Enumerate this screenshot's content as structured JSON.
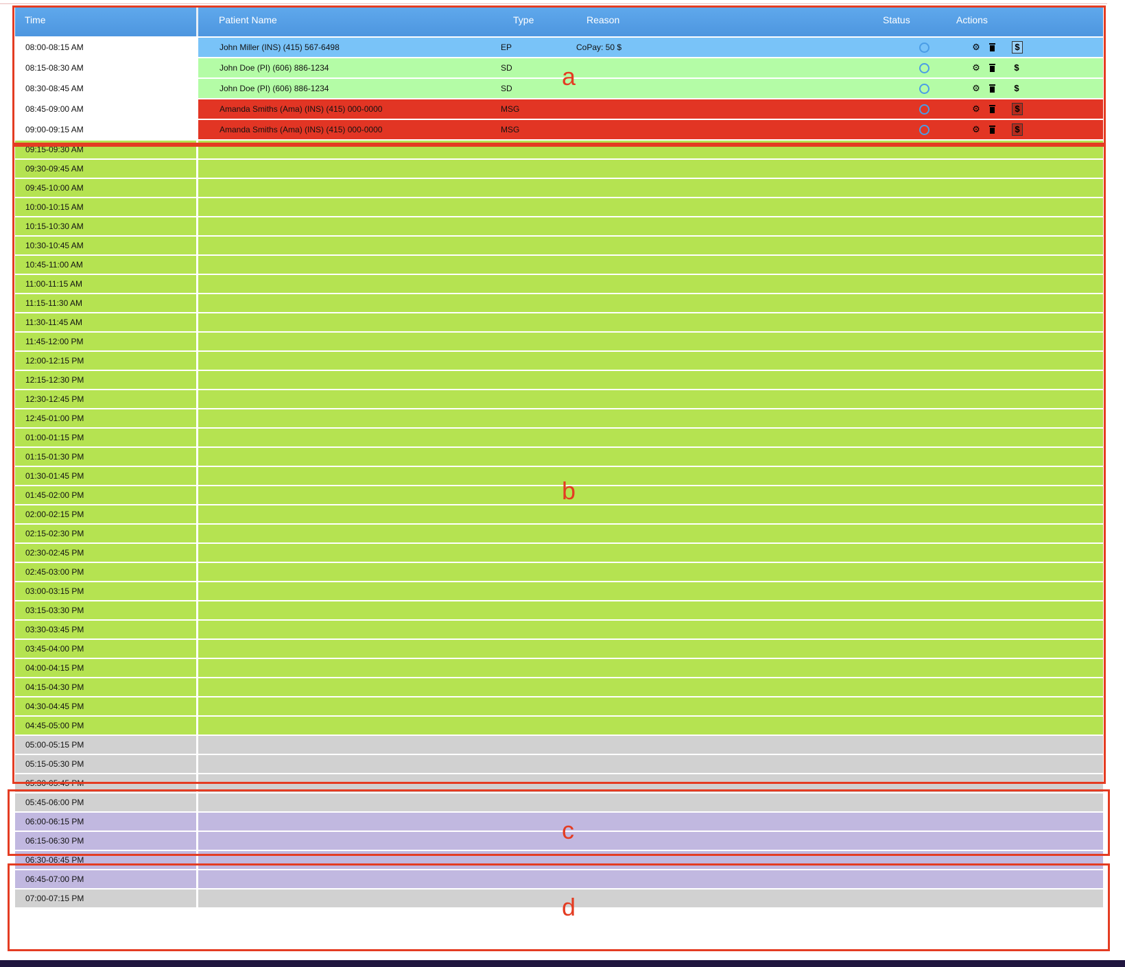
{
  "header": {
    "time": "Time",
    "patient_name": "Patient Name",
    "type": "Type",
    "reason": "Reason",
    "status": "Status",
    "actions": "Actions"
  },
  "appointments": [
    {
      "time": "08:00-08:15 AM",
      "patient": "John Miller (INS)  (415) 567-6498",
      "type": "EP",
      "reason": "CoPay: 50 $"
    },
    {
      "time": "08:15-08:30 AM",
      "patient": "John Doe (PI)  (606) 886-1234",
      "type": "SD",
      "reason": ""
    },
    {
      "time": "08:30-08:45 AM",
      "patient": "John Doe (PI)  (606) 886-1234",
      "type": "SD",
      "reason": ""
    },
    {
      "time": "08:45-09:00 AM",
      "patient": "Amanda Smiths (Ama) (INS)  (415) 000-0000",
      "type": "MSG",
      "reason": ""
    },
    {
      "time": "09:00-09:15 AM",
      "patient": "Amanda Smiths (Ama) (INS)  (415) 000-0000",
      "type": "MSG",
      "reason": ""
    }
  ],
  "open_slots": [
    "09:15-09:30 AM",
    "09:30-09:45 AM",
    "09:45-10:00 AM",
    "10:00-10:15 AM",
    "10:15-10:30 AM",
    "10:30-10:45 AM",
    "10:45-11:00 AM",
    "11:00-11:15 AM",
    "11:15-11:30 AM",
    "11:30-11:45 AM",
    "11:45-12:00 PM",
    "12:00-12:15 PM",
    "12:15-12:30 PM",
    "12:30-12:45 PM",
    "12:45-01:00 PM",
    "01:00-01:15 PM",
    "01:15-01:30 PM",
    "01:30-01:45 PM",
    "01:45-02:00 PM",
    "02:00-02:15 PM",
    "02:15-02:30 PM",
    "02:30-02:45 PM",
    "02:45-03:00 PM",
    "03:00-03:15 PM",
    "03:15-03:30 PM",
    "03:30-03:45 PM",
    "03:45-04:00 PM",
    "04:00-04:15 PM",
    "04:15-04:30 PM",
    "04:30-04:45 PM",
    "04:45-05:00 PM"
  ],
  "gray_slots": [
    "05:00-05:15 PM",
    "05:15-05:30 PM",
    "05:30-05:45 PM",
    "05:45-06:00 PM"
  ],
  "purple_slots": [
    "06:00-06:15 PM",
    "06:15-06:30 PM",
    "06:30-06:45 PM",
    "06:45-07:00 PM"
  ],
  "trailing_slots": [
    "07:00-07:15 PM"
  ],
  "annotations": {
    "a": "a",
    "b": "b",
    "c": "c",
    "d": "d"
  },
  "icons": {
    "status": "circle-icon",
    "edit": "gear-icon",
    "delete": "trash-icon",
    "billing": "dollar-icon"
  },
  "colors": {
    "header": "#4d96df",
    "selected_row": "#79c3f8",
    "booked_pi": "#b4fca6",
    "booked_msg": "#e23524",
    "available": "#b5e351",
    "after_hours": "#d1d1d1",
    "evening": "#c1b8e0",
    "annotation": "#e43c22"
  }
}
